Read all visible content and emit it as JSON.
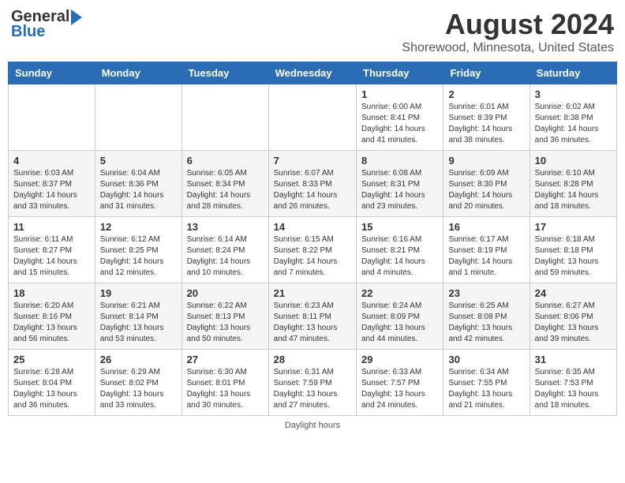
{
  "header": {
    "logo_general": "General",
    "logo_blue": "Blue",
    "month_year": "August 2024",
    "location": "Shorewood, Minnesota, United States"
  },
  "days_of_week": [
    "Sunday",
    "Monday",
    "Tuesday",
    "Wednesday",
    "Thursday",
    "Friday",
    "Saturday"
  ],
  "footer": {
    "daylight_label": "Daylight hours"
  },
  "weeks": [
    {
      "days": [
        {
          "num": "",
          "info": ""
        },
        {
          "num": "",
          "info": ""
        },
        {
          "num": "",
          "info": ""
        },
        {
          "num": "",
          "info": ""
        },
        {
          "num": "1",
          "info": "Sunrise: 6:00 AM\nSunset: 8:41 PM\nDaylight: 14 hours\nand 41 minutes."
        },
        {
          "num": "2",
          "info": "Sunrise: 6:01 AM\nSunset: 8:39 PM\nDaylight: 14 hours\nand 38 minutes."
        },
        {
          "num": "3",
          "info": "Sunrise: 6:02 AM\nSunset: 8:38 PM\nDaylight: 14 hours\nand 36 minutes."
        }
      ]
    },
    {
      "days": [
        {
          "num": "4",
          "info": "Sunrise: 6:03 AM\nSunset: 8:37 PM\nDaylight: 14 hours\nand 33 minutes."
        },
        {
          "num": "5",
          "info": "Sunrise: 6:04 AM\nSunset: 8:36 PM\nDaylight: 14 hours\nand 31 minutes."
        },
        {
          "num": "6",
          "info": "Sunrise: 6:05 AM\nSunset: 8:34 PM\nDaylight: 14 hours\nand 28 minutes."
        },
        {
          "num": "7",
          "info": "Sunrise: 6:07 AM\nSunset: 8:33 PM\nDaylight: 14 hours\nand 26 minutes."
        },
        {
          "num": "8",
          "info": "Sunrise: 6:08 AM\nSunset: 8:31 PM\nDaylight: 14 hours\nand 23 minutes."
        },
        {
          "num": "9",
          "info": "Sunrise: 6:09 AM\nSunset: 8:30 PM\nDaylight: 14 hours\nand 20 minutes."
        },
        {
          "num": "10",
          "info": "Sunrise: 6:10 AM\nSunset: 8:28 PM\nDaylight: 14 hours\nand 18 minutes."
        }
      ]
    },
    {
      "days": [
        {
          "num": "11",
          "info": "Sunrise: 6:11 AM\nSunset: 8:27 PM\nDaylight: 14 hours\nand 15 minutes."
        },
        {
          "num": "12",
          "info": "Sunrise: 6:12 AM\nSunset: 8:25 PM\nDaylight: 14 hours\nand 12 minutes."
        },
        {
          "num": "13",
          "info": "Sunrise: 6:14 AM\nSunset: 8:24 PM\nDaylight: 14 hours\nand 10 minutes."
        },
        {
          "num": "14",
          "info": "Sunrise: 6:15 AM\nSunset: 8:22 PM\nDaylight: 14 hours\nand 7 minutes."
        },
        {
          "num": "15",
          "info": "Sunrise: 6:16 AM\nSunset: 8:21 PM\nDaylight: 14 hours\nand 4 minutes."
        },
        {
          "num": "16",
          "info": "Sunrise: 6:17 AM\nSunset: 8:19 PM\nDaylight: 14 hours\nand 1 minute."
        },
        {
          "num": "17",
          "info": "Sunrise: 6:18 AM\nSunset: 8:18 PM\nDaylight: 13 hours\nand 59 minutes."
        }
      ]
    },
    {
      "days": [
        {
          "num": "18",
          "info": "Sunrise: 6:20 AM\nSunset: 8:16 PM\nDaylight: 13 hours\nand 56 minutes."
        },
        {
          "num": "19",
          "info": "Sunrise: 6:21 AM\nSunset: 8:14 PM\nDaylight: 13 hours\nand 53 minutes."
        },
        {
          "num": "20",
          "info": "Sunrise: 6:22 AM\nSunset: 8:13 PM\nDaylight: 13 hours\nand 50 minutes."
        },
        {
          "num": "21",
          "info": "Sunrise: 6:23 AM\nSunset: 8:11 PM\nDaylight: 13 hours\nand 47 minutes."
        },
        {
          "num": "22",
          "info": "Sunrise: 6:24 AM\nSunset: 8:09 PM\nDaylight: 13 hours\nand 44 minutes."
        },
        {
          "num": "23",
          "info": "Sunrise: 6:25 AM\nSunset: 8:08 PM\nDaylight: 13 hours\nand 42 minutes."
        },
        {
          "num": "24",
          "info": "Sunrise: 6:27 AM\nSunset: 8:06 PM\nDaylight: 13 hours\nand 39 minutes."
        }
      ]
    },
    {
      "days": [
        {
          "num": "25",
          "info": "Sunrise: 6:28 AM\nSunset: 8:04 PM\nDaylight: 13 hours\nand 36 minutes."
        },
        {
          "num": "26",
          "info": "Sunrise: 6:29 AM\nSunset: 8:02 PM\nDaylight: 13 hours\nand 33 minutes."
        },
        {
          "num": "27",
          "info": "Sunrise: 6:30 AM\nSunset: 8:01 PM\nDaylight: 13 hours\nand 30 minutes."
        },
        {
          "num": "28",
          "info": "Sunrise: 6:31 AM\nSunset: 7:59 PM\nDaylight: 13 hours\nand 27 minutes."
        },
        {
          "num": "29",
          "info": "Sunrise: 6:33 AM\nSunset: 7:57 PM\nDaylight: 13 hours\nand 24 minutes."
        },
        {
          "num": "30",
          "info": "Sunrise: 6:34 AM\nSunset: 7:55 PM\nDaylight: 13 hours\nand 21 minutes."
        },
        {
          "num": "31",
          "info": "Sunrise: 6:35 AM\nSunset: 7:53 PM\nDaylight: 13 hours\nand 18 minutes."
        }
      ]
    }
  ]
}
